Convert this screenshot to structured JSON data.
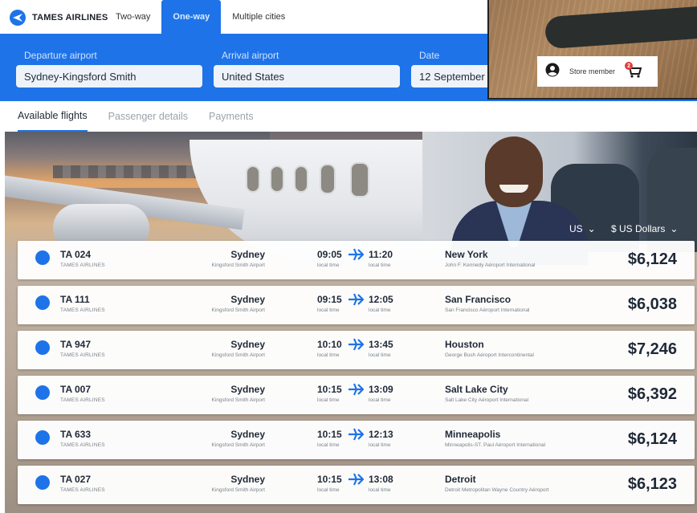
{
  "brand": {
    "name": "TAMES AIRLINES"
  },
  "trip_tabs": [
    {
      "label": "Two-way",
      "active": false
    },
    {
      "label": "One-way",
      "active": true
    },
    {
      "label": "Multiple cities",
      "active": false
    }
  ],
  "search": {
    "departure_label": "Departure airport",
    "departure_value": "Sydney-Kingsford Smith",
    "arrival_label": "Arrival airport",
    "arrival_value": "United States",
    "date_label": "Date",
    "date_value": "12 September"
  },
  "overlay": {
    "store_member_label": "Store member",
    "cart_count": "2"
  },
  "sub_tabs": [
    {
      "label": "Available flights",
      "active": true
    },
    {
      "label": "Passenger details",
      "active": false
    },
    {
      "label": "Payments",
      "active": false
    }
  ],
  "currency": {
    "country": "US",
    "money": "$ US Dollars"
  },
  "local_time_label": "local time",
  "flights": [
    {
      "number": "TA 024",
      "airline": "TAMES AIRLINES",
      "origin": "Sydney",
      "origin_airport": "Kingsford Smith Airport",
      "depart": "09:05",
      "arrive": "11:20",
      "destination": "New York",
      "destination_airport": "John F. Kennedy Aéroport International",
      "price": "$6,124"
    },
    {
      "number": "TA 111",
      "airline": "TAMES AIRLINES",
      "origin": "Sydney",
      "origin_airport": "Kingsford Smith Airport",
      "depart": "09:15",
      "arrive": "12:05",
      "destination": "San Francisco",
      "destination_airport": "San Francisco Aéroport International",
      "price": "$6,038"
    },
    {
      "number": "TA 947",
      "airline": "TAMES AIRLINES",
      "origin": "Sydney",
      "origin_airport": "Kingsford Smith Airport",
      "depart": "10:10",
      "arrive": "13:45",
      "destination": "Houston",
      "destination_airport": "George Bush Aéroport Intercontinental",
      "price": "$7,246"
    },
    {
      "number": "TA 007",
      "airline": "TAMES AIRLINES",
      "origin": "Sydney",
      "origin_airport": "Kingsford Smith Airport",
      "depart": "10:15",
      "arrive": "13:09",
      "destination": "Salt Lake City",
      "destination_airport": "Salt Lake City Aéroport International",
      "price": "$6,392"
    },
    {
      "number": "TA 633",
      "airline": "TAMES AIRLINES",
      "origin": "Sydney",
      "origin_airport": "Kingsford Smith Airport",
      "depart": "10:15",
      "arrive": "12:13",
      "destination": "Minneapolis",
      "destination_airport": "Minneapolis-ST. Paul Aéroport International",
      "price": "$6,124"
    },
    {
      "number": "TA 027",
      "airline": "TAMES AIRLINES",
      "origin": "Sydney",
      "origin_airport": "Kingsford Smith Airport",
      "depart": "10:15",
      "arrive": "13:08",
      "destination": "Detroit",
      "destination_airport": "Detroit Metropolitan Wayne Country Aéroport",
      "price": "$6,123"
    }
  ],
  "colors": {
    "accent": "#1e73e8",
    "badge": "#e23b3b"
  }
}
